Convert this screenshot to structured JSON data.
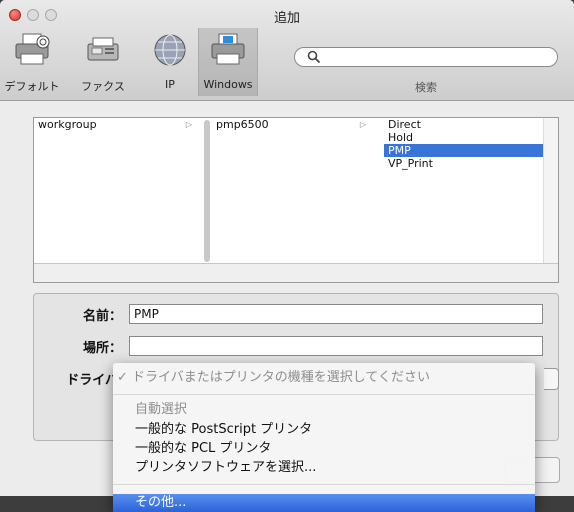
{
  "window": {
    "title": "追加"
  },
  "toolbar": {
    "items": [
      {
        "label": "デフォルト",
        "icon": "printer-icon"
      },
      {
        "label": "ファクス",
        "icon": "fax-icon"
      },
      {
        "label": "IP",
        "icon": "globe-icon"
      },
      {
        "label": "Windows",
        "icon": "windows-printer-icon",
        "selected": true
      }
    ],
    "search": {
      "value": "",
      "label": "検索"
    }
  },
  "browser": {
    "col1": [
      "workgroup"
    ],
    "col2": [
      "pmp6500"
    ],
    "col3": [
      "Direct",
      "Hold",
      "PMP",
      "VP_Print"
    ],
    "col3_selected": "PMP"
  },
  "form": {
    "name_label": "名前：",
    "name_value": "PMP",
    "location_label": "場所：",
    "location_value": "",
    "driver_label": "ドライバ"
  },
  "driver_menu": {
    "checked_item": "ドライバまたはプリンタの機種を選択してください",
    "check_mark": "✓",
    "items": [
      {
        "label": "自動選択",
        "disabled": true
      },
      {
        "label": "一般的な PostScript プリンタ"
      },
      {
        "label": "一般的な PCL プリンタ"
      },
      {
        "label": "プリンタソフトウェアを選択..."
      },
      {
        "label": "その他...",
        "highlighted": true
      }
    ]
  },
  "colors": {
    "selection": "#3875d7",
    "menu_highlight": "#2c62d8",
    "close_button": "#d8322b"
  }
}
